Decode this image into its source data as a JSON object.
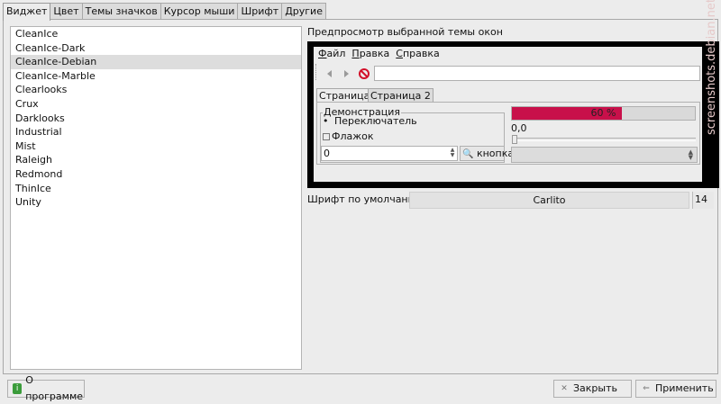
{
  "tabs": [
    "Виджет",
    "Цвет",
    "Темы значков",
    "Курсор мыши",
    "Шрифт",
    "Другие"
  ],
  "themes": [
    "CleanIce",
    "CleanIce-Dark",
    "CleanIce-Debian",
    "CleanIce-Marble",
    "Clearlooks",
    "Crux",
    "Darklooks",
    "Industrial",
    "Mist",
    "Raleigh",
    "Redmond",
    "ThinIce",
    "Unity"
  ],
  "selected_theme": "CleanIce-Debian",
  "preview": {
    "title": "Предпросмотр выбранной темы окон",
    "menu": [
      "Файл",
      "Правка",
      "Справка"
    ],
    "tabs": [
      "Страница 1",
      "Страница 2"
    ],
    "group_title": "Демонстрация",
    "radio_label": "Переключатель",
    "checkbox_label": "Флажок",
    "spin_value": "0",
    "button_label": "кнопка",
    "progress_text": "60 %",
    "progress_value": 0.6,
    "progress_color": "#c8104a",
    "slider_value": "0,0"
  },
  "font": {
    "label": "Шрифт по умолчанию:",
    "name": "Carlito",
    "size": "14"
  },
  "buttons": {
    "about": "О программе",
    "close": "Закрыть",
    "apply": "Применить"
  },
  "watermark": "screenshots.debian.net"
}
